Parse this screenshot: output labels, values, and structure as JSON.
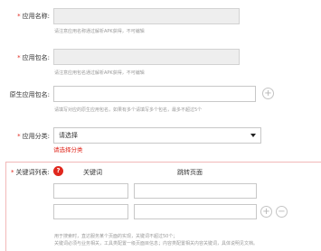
{
  "form": {
    "required_mark": "*",
    "app_name": {
      "label": "应用名称:",
      "value": "",
      "hint": "请注意应用名称通过解析APK获得，不可编辑"
    },
    "app_package": {
      "label": "应用包名:",
      "value": "",
      "hint": "请注意应用包名通过解析APK获得，不可编辑"
    },
    "native_package": {
      "label": "原生应用包名:",
      "value": "",
      "hint": "请填写对应的原生应用包名，如果有多个请填写多个包名，最多不超过5个"
    },
    "app_category": {
      "label": "应用分类:",
      "selected": "请选择",
      "error": "请选择分类"
    },
    "keywords": {
      "label": "关键词列表:",
      "help_icon": "question-icon",
      "col_keyword": "关键词",
      "col_page": "跳转页面",
      "rows": [
        {
          "keyword": "",
          "page": ""
        },
        {
          "keyword": "",
          "page": ""
        }
      ],
      "note_line1": "用于搜索时，直达服务某个页面的实现，关键词不超过50个；",
      "note_line2": "关键词必须与业务相关，工具类配置一级页面目信息；内容类配置相关内容关键词，具体说明见文档。"
    }
  },
  "icons": {
    "add": "plus-circle-icon",
    "remove": "minus-circle-icon",
    "dropdown": "chevron-down-icon"
  },
  "colors": {
    "required": "#e0271d",
    "error": "#e0271d",
    "hint": "#9a9a9a",
    "disabled_bg": "#eeeeee",
    "keyword_border": "#f2b8b8"
  }
}
